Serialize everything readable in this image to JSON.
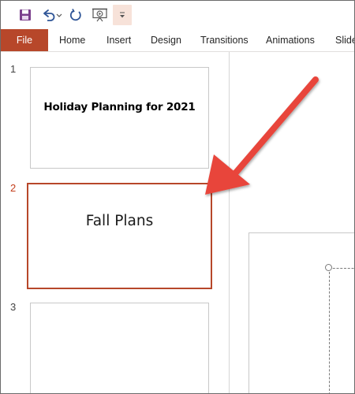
{
  "quick_access": {
    "save_icon": "save-icon",
    "undo_icon": "undo-icon",
    "redo_icon": "redo-icon",
    "present_icon": "present-from-beginning-icon",
    "customize_icon": "customize-toolbar-icon"
  },
  "ribbon": {
    "tabs": [
      "File",
      "Home",
      "Insert",
      "Design",
      "Transitions",
      "Animations",
      "Slide"
    ],
    "file_color": "#b7472a"
  },
  "slides": [
    {
      "number": "1",
      "title": "Holiday Planning for 2021"
    },
    {
      "number": "2",
      "title": "Fall Plans",
      "selected": true
    },
    {
      "number": "3",
      "title": ""
    }
  ],
  "colors": {
    "accent": "#b7472a",
    "arrow": "#e8443a"
  }
}
